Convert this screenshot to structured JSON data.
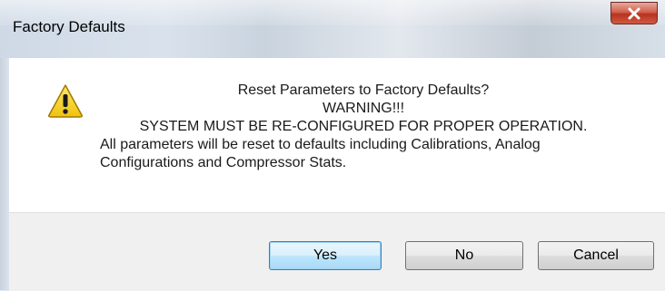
{
  "window": {
    "title": "Factory Defaults",
    "close_icon": "close-icon"
  },
  "dialog": {
    "icon": "warning-icon",
    "line1": "Reset Parameters to Factory Defaults?",
    "line2": "WARNING!!!",
    "line3": "SYSTEM MUST BE RE-CONFIGURED FOR PROPER OPERATION.",
    "line4": "All parameters will be reset to defaults including Calibrations, Analog",
    "line5": "Configurations and Compressor Stats."
  },
  "buttons": {
    "yes": "Yes",
    "no": "No",
    "cancel": "Cancel"
  },
  "colors": {
    "close_button": "#c9472f",
    "default_button_border": "#3c7fb1",
    "warning_yellow": "#f5d31a"
  }
}
